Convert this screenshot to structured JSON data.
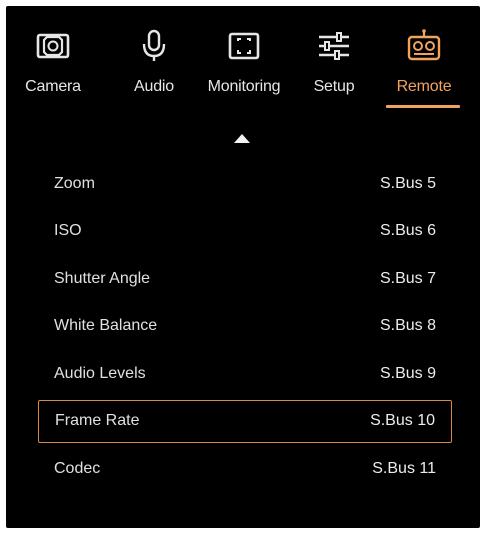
{
  "tabs": [
    {
      "id": "camera",
      "label": "Camera",
      "icon": "camera-icon",
      "active": false
    },
    {
      "id": "audio",
      "label": "Audio",
      "icon": "microphone-icon",
      "active": false
    },
    {
      "id": "monitoring",
      "label": "Monitoring",
      "icon": "monitor-focus-icon",
      "active": false
    },
    {
      "id": "setup",
      "label": "Setup",
      "icon": "sliders-icon",
      "active": false
    },
    {
      "id": "remote",
      "label": "Remote",
      "icon": "remote-control-icon",
      "active": true
    }
  ],
  "colors": {
    "accent": "#f0a35e",
    "background": "#000000",
    "text": "#e6e6e6"
  },
  "list": {
    "items": [
      {
        "name": "Zoom",
        "value": "S.Bus 5"
      },
      {
        "name": "ISO",
        "value": "S.Bus 6"
      },
      {
        "name": "Shutter Angle",
        "value": "S.Bus 7"
      },
      {
        "name": "White Balance",
        "value": "S.Bus 8"
      },
      {
        "name": "Audio Levels",
        "value": "S.Bus 9"
      },
      {
        "name": "Frame Rate",
        "value": "S.Bus 10"
      },
      {
        "name": "Codec",
        "value": "S.Bus 11"
      }
    ],
    "selected_index": 5
  }
}
